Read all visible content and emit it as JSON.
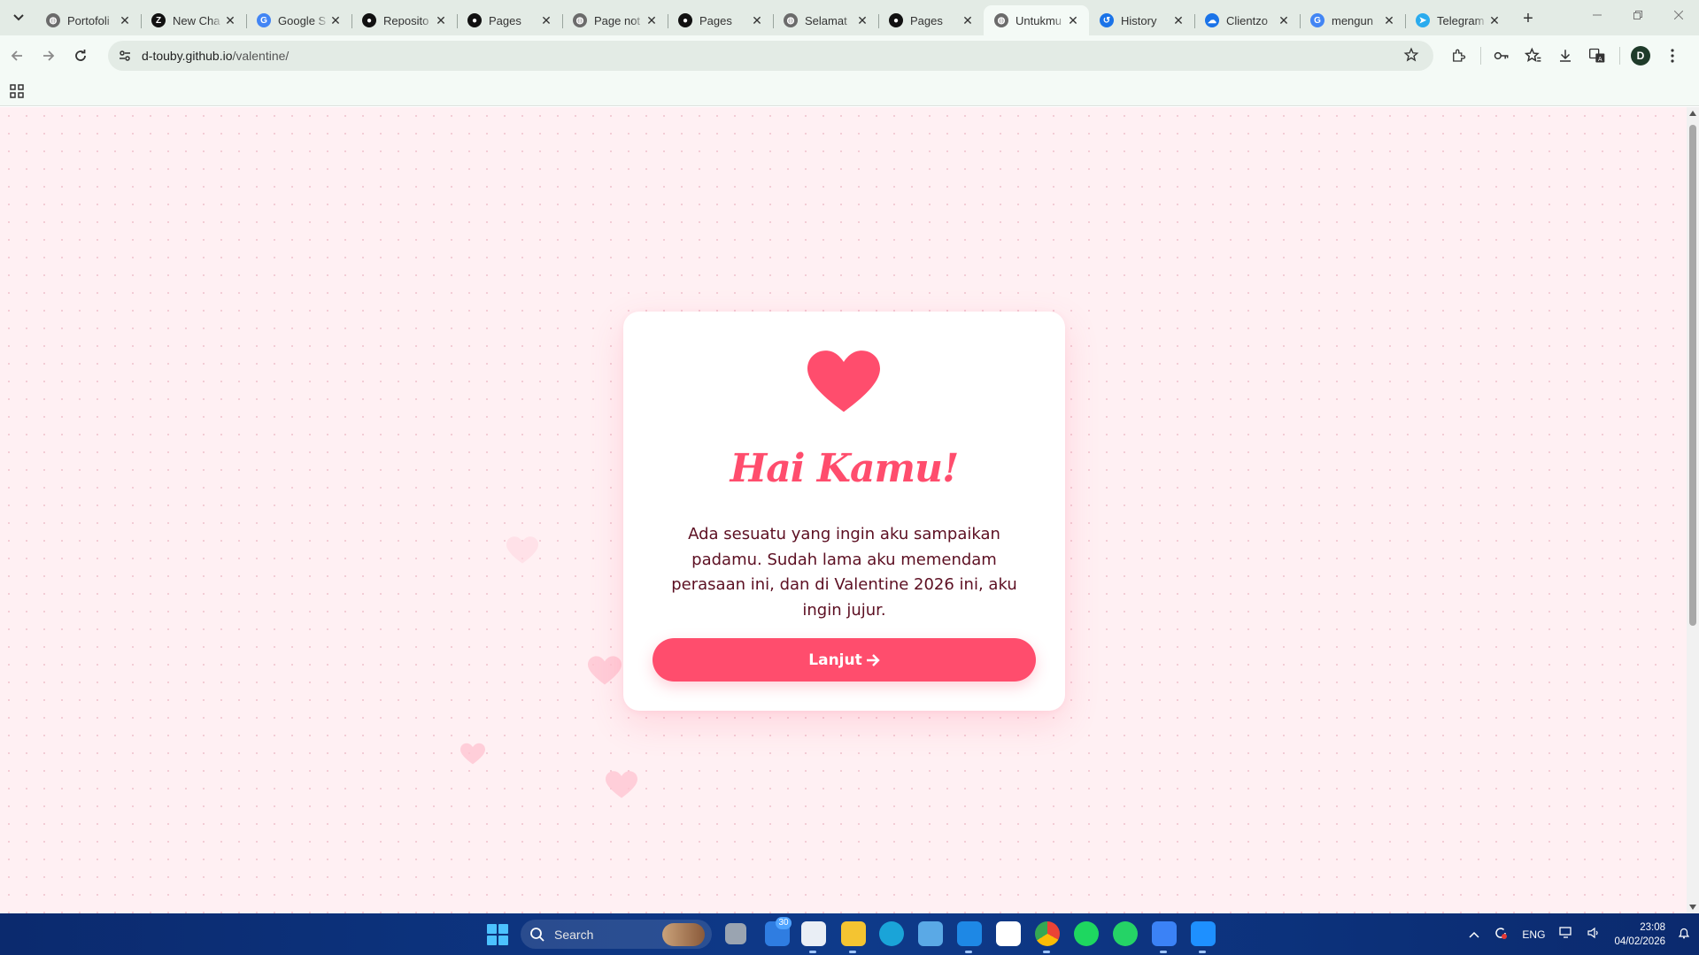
{
  "browser": {
    "tabs": [
      {
        "title": "Portofoli",
        "favicon": "globe-icon",
        "color": "#6b6b6b"
      },
      {
        "title": "New Cha",
        "favicon": "z-logo-icon",
        "color": "#111111"
      },
      {
        "title": "Google S",
        "favicon": "google-icon",
        "color": "#4285f4"
      },
      {
        "title": "Reposito",
        "favicon": "github-icon",
        "color": "#111111"
      },
      {
        "title": "Pages",
        "favicon": "github-icon",
        "color": "#111111"
      },
      {
        "title": "Page not",
        "favicon": "globe-icon",
        "color": "#6b6b6b"
      },
      {
        "title": "Pages",
        "favicon": "github-icon",
        "color": "#111111"
      },
      {
        "title": "Selamat",
        "favicon": "globe-icon",
        "color": "#6b6b6b"
      },
      {
        "title": "Pages",
        "favicon": "github-icon",
        "color": "#111111"
      },
      {
        "title": "Untukmu",
        "favicon": "globe-icon",
        "color": "#6b6b6b",
        "active": true
      },
      {
        "title": "History",
        "favicon": "history-icon",
        "color": "#1a73e8"
      },
      {
        "title": "Clientzo",
        "favicon": "cloud-icon",
        "color": "#1a73e8"
      },
      {
        "title": "mengun",
        "favicon": "google-icon",
        "color": "#4285f4"
      },
      {
        "title": "Telegram",
        "favicon": "telegram-icon",
        "color": "#2aabee"
      }
    ],
    "url_host": "d-touby.github.io",
    "url_path": "/valentine/",
    "profile_initial": "D"
  },
  "card": {
    "icon": "heart-icon",
    "title": "Hai Kamu!",
    "message": "Ada sesuatu yang ingin aku sampaikan padamu. Sudah lama aku memendam perasaan ini, dan di Valentine 2026 ini, aku ingin jujur.",
    "button_label": "Lanjut"
  },
  "colors": {
    "accent": "#ff4d6d",
    "text": "#5c0f22",
    "background": "#fff0f3"
  },
  "taskbar": {
    "search_label": "Search",
    "badge_count": "30",
    "language": "ENG",
    "time": "23:08",
    "date": "04/02/2026"
  }
}
